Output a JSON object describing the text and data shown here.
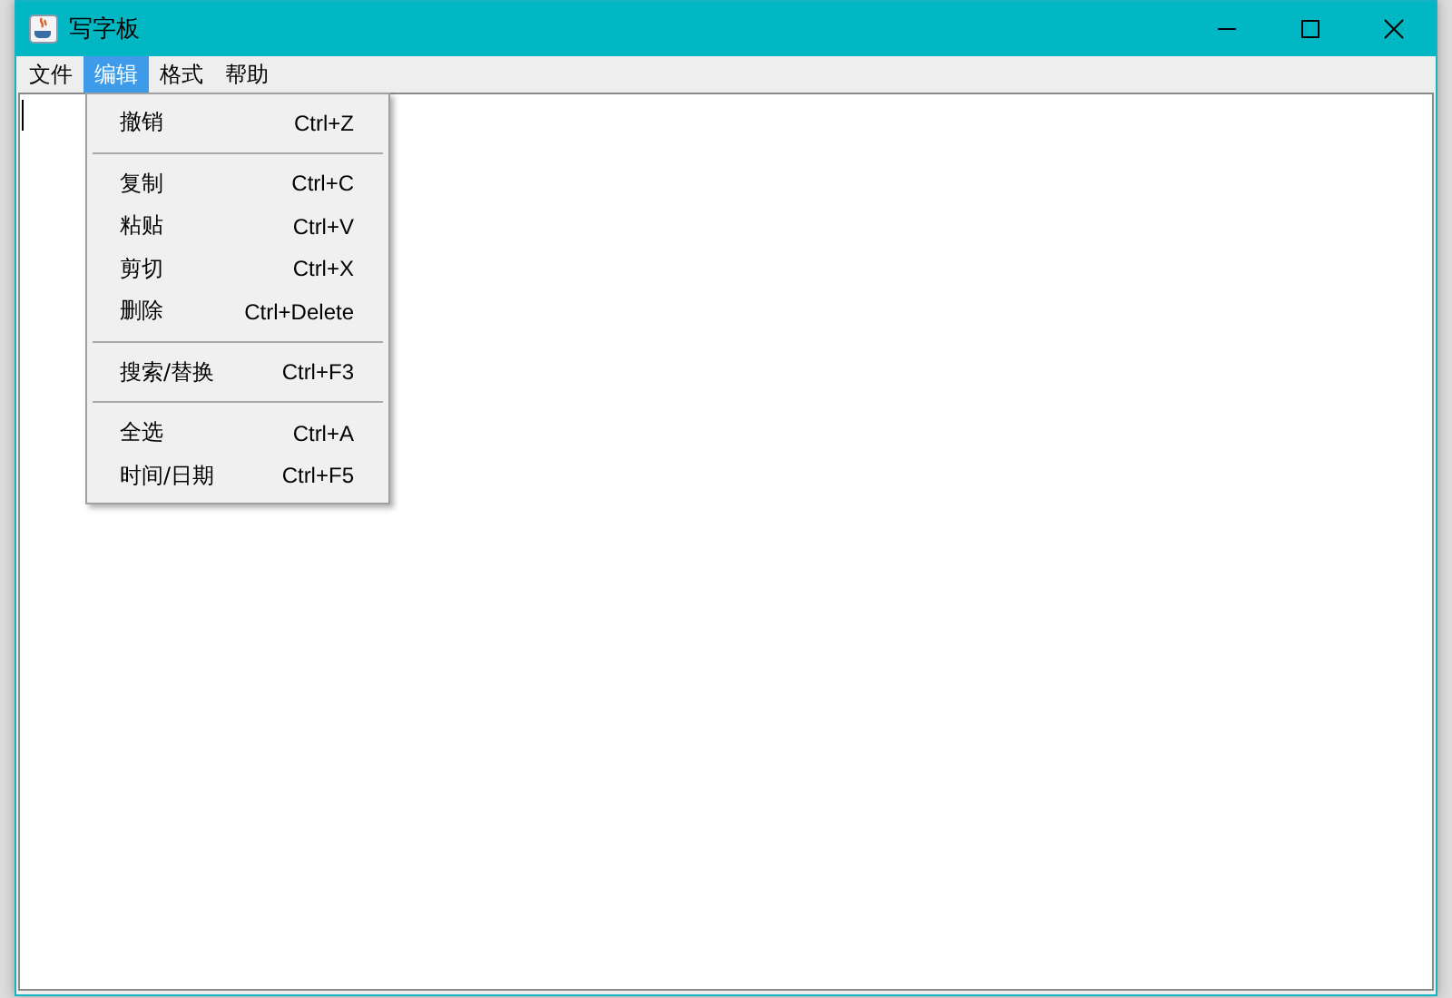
{
  "window": {
    "title": "写字板"
  },
  "menu_bar": [
    {
      "label": "文件",
      "selected": false
    },
    {
      "label": "编辑",
      "selected": true
    },
    {
      "label": "格式",
      "selected": false
    },
    {
      "label": "帮助",
      "selected": false
    }
  ],
  "dropdown": [
    {
      "kind": "item",
      "label": "撤销",
      "shortcut": "Ctrl+Z"
    },
    {
      "kind": "separator"
    },
    {
      "kind": "item",
      "label": "复制",
      "shortcut": "Ctrl+C"
    },
    {
      "kind": "item",
      "label": "粘贴",
      "shortcut": "Ctrl+V"
    },
    {
      "kind": "item",
      "label": "剪切",
      "shortcut": "Ctrl+X"
    },
    {
      "kind": "item",
      "label": "删除",
      "shortcut": "Ctrl+Delete"
    },
    {
      "kind": "separator"
    },
    {
      "kind": "item",
      "label": "搜索/替换",
      "shortcut": "Ctrl+F3"
    },
    {
      "kind": "separator"
    },
    {
      "kind": "item",
      "label": "全选",
      "shortcut": "Ctrl+A"
    },
    {
      "kind": "item",
      "label": "时间/日期",
      "shortcut": "Ctrl+F5"
    }
  ]
}
